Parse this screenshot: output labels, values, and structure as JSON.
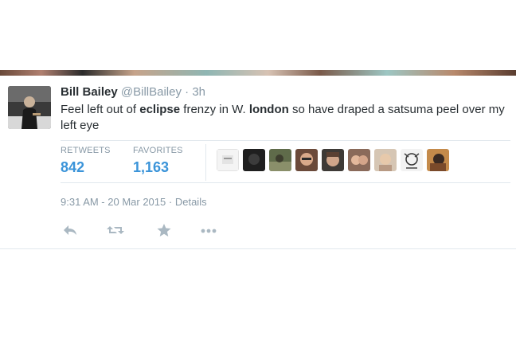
{
  "tweet": {
    "author_name": "Bill Bailey",
    "handle": "@BillBailey",
    "separator": "·",
    "age": "3h",
    "text_parts": [
      "Feel left out of ",
      "eclipse",
      " frenzy in W. ",
      "london",
      " so have draped a satsuma peel over my left eye"
    ],
    "stats": {
      "retweets_label": "RETWEETS",
      "retweets_value": "842",
      "favorites_label": "FAVORITES",
      "favorites_value": "1,163"
    },
    "timestamp": "9:31 AM - 20 Mar 2015",
    "meta_separator": "·",
    "details_link": "Details"
  },
  "actions": [
    "reply-icon",
    "retweet-icon",
    "favorite-icon",
    "more-icon"
  ],
  "colors": {
    "accent": "#3b94d9",
    "text": "#292f33",
    "muted": "#8899a6",
    "border": "#e1e8ed"
  }
}
